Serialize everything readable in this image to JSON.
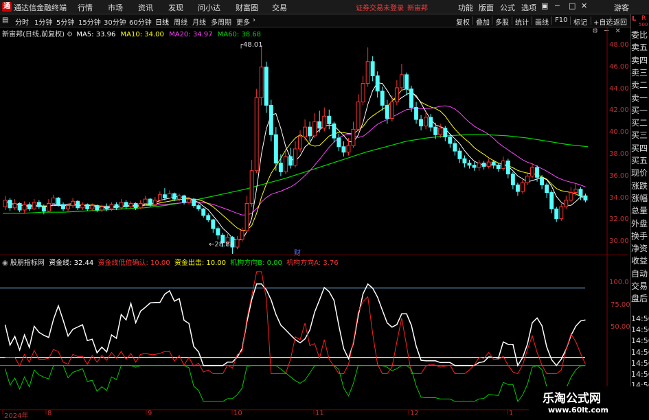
{
  "menubar": {
    "app_title": "通达信金融终端",
    "items": [
      "行情",
      "市场",
      "资讯",
      "发现",
      "问小达",
      "财富圈",
      "交易"
    ],
    "warning": "证券交易未登录",
    "stock": "新宙邦",
    "right_items": [
      "功能",
      "版面",
      "公式",
      "选项"
    ],
    "guest": "游客"
  },
  "periodbar": {
    "items": [
      "分时",
      "1分钟",
      "5分钟",
      "15分钟",
      "30分钟",
      "60分钟",
      "日线",
      "周线",
      "月线",
      "多周期",
      "更多"
    ],
    "active": "日线",
    "tools": [
      "复权",
      "叠加",
      "多股",
      "统计",
      "画线",
      "F10",
      "标记",
      "+自选",
      "返回"
    ]
  },
  "info": {
    "name": "新宙邦(日线,前复权)",
    "ma5": "MA5: 33.96",
    "ma10": "MA10: 34.00",
    "ma20": "MA20: 34.97",
    "ma60": "MA60: 38.68"
  },
  "colors": {
    "up": "#ff3232",
    "down": "#54ffff",
    "ma5": "#ffffff",
    "ma10": "#ffff00",
    "ma20": "#ff44ff",
    "ma60": "#00dd00"
  },
  "side_labels": [
    "委比",
    "卖五",
    "卖四",
    "卖三",
    "卖二",
    "卖一",
    "买一",
    "买二",
    "买三",
    "买四",
    "买五",
    "现价",
    "涨跌",
    "涨幅",
    "总量",
    "外盘",
    "换手",
    "净资",
    "收益",
    "自动",
    "交易",
    "盘后"
  ],
  "side_top": {
    "l": "L",
    "r": "R",
    "num": "500"
  },
  "price_axis": [
    "48.00",
    "46.00",
    "44.00",
    "42.00",
    "40.00",
    "38.00",
    "36.00",
    "34.00",
    "32.00",
    "30.00"
  ],
  "annotations": {
    "high": "48.01",
    "low": "28.88",
    "event": "财"
  },
  "indicator": {
    "name": "股朋指标网",
    "zjx": "资金线: 32.44",
    "dw": "资金线低位确认: 10.00",
    "cj": "资金出击: 10.00",
    "jgb": "机构方向B: 0.00",
    "jga": "机构方向A: 3.76",
    "axis": [
      "100.0",
      "75.00",
      "50.00"
    ],
    "time_labels": [
      "14:56",
      "14:56",
      "14:56",
      "14:56",
      "14:56",
      "14:56",
      "14:56"
    ]
  },
  "x_axis": [
    "2024年",
    "8",
    "9",
    "10",
    "11",
    "12",
    "1"
  ],
  "watermark": {
    "line1": "乐淘公式网",
    "line2": "www.60lt.com"
  },
  "chart_data": {
    "type": "candlestick",
    "title": "新宙邦(日线,前复权)",
    "price_range": [
      29.0,
      48.5
    ],
    "candles": [
      [
        33.2,
        33.8,
        34.2,
        32.9
      ],
      [
        33.8,
        33.1,
        34.0,
        32.8
      ],
      [
        33.1,
        33.5,
        33.9,
        32.9
      ],
      [
        33.5,
        32.9,
        33.6,
        32.7
      ],
      [
        32.9,
        33.4,
        33.7,
        32.6
      ],
      [
        33.4,
        33.0,
        33.6,
        32.8
      ],
      [
        33.0,
        33.6,
        33.9,
        32.9
      ],
      [
        33.6,
        33.2,
        33.8,
        33.0
      ],
      [
        33.2,
        32.8,
        33.4,
        32.5
      ],
      [
        32.8,
        33.5,
        33.9,
        32.7
      ],
      [
        33.5,
        34.0,
        34.3,
        33.3
      ],
      [
        34.0,
        33.4,
        34.1,
        33.2
      ],
      [
        33.4,
        33.0,
        33.6,
        32.8
      ],
      [
        33.0,
        33.3,
        33.5,
        32.8
      ],
      [
        33.3,
        33.7,
        34.0,
        33.1
      ],
      [
        33.7,
        33.1,
        33.8,
        32.9
      ],
      [
        33.1,
        33.4,
        33.6,
        32.9
      ],
      [
        33.4,
        33.0,
        33.5,
        32.8
      ],
      [
        33.0,
        33.3,
        33.5,
        32.8
      ],
      [
        33.3,
        32.9,
        33.4,
        32.7
      ],
      [
        32.9,
        33.2,
        33.4,
        32.7
      ],
      [
        33.2,
        33.0,
        33.5,
        32.8
      ],
      [
        33.0,
        33.4,
        33.6,
        32.8
      ],
      [
        33.4,
        33.1,
        33.6,
        32.9
      ],
      [
        33.1,
        33.6,
        33.9,
        33.0
      ],
      [
        33.6,
        33.2,
        33.8,
        33.0
      ],
      [
        33.2,
        33.5,
        33.7,
        33.0
      ],
      [
        33.5,
        33.1,
        33.6,
        32.9
      ],
      [
        33.1,
        33.5,
        33.8,
        33.0
      ],
      [
        33.5,
        33.9,
        34.2,
        33.3
      ],
      [
        33.9,
        33.4,
        34.0,
        33.2
      ],
      [
        33.4,
        33.8,
        34.1,
        33.2
      ],
      [
        33.8,
        34.3,
        34.6,
        33.6
      ],
      [
        34.3,
        34.0,
        34.9,
        33.8
      ],
      [
        34.0,
        34.4,
        34.7,
        33.9
      ],
      [
        34.4,
        33.9,
        34.5,
        33.7
      ],
      [
        33.9,
        34.2,
        34.4,
        33.7
      ],
      [
        34.2,
        33.6,
        34.3,
        33.4
      ],
      [
        33.6,
        33.9,
        34.1,
        33.4
      ],
      [
        33.9,
        33.3,
        34.0,
        33.1
      ],
      [
        33.3,
        33.0,
        33.5,
        32.8
      ],
      [
        33.0,
        32.4,
        33.1,
        32.2
      ],
      [
        32.4,
        32.0,
        32.6,
        31.8
      ],
      [
        32.0,
        31.2,
        32.1,
        30.8
      ],
      [
        31.2,
        30.6,
        31.4,
        30.2
      ],
      [
        30.6,
        29.9,
        30.8,
        29.5
      ],
      [
        29.9,
        30.4,
        30.7,
        29.6
      ],
      [
        30.4,
        29.5,
        30.5,
        28.88
      ],
      [
        29.5,
        30.2,
        30.5,
        29.3
      ],
      [
        30.2,
        31.0,
        31.3,
        30.0
      ],
      [
        31.0,
        33.5,
        34.2,
        30.9
      ],
      [
        33.5,
        36.5,
        37.5,
        33.2
      ],
      [
        36.5,
        43.2,
        44.0,
        36.3
      ],
      [
        43.2,
        46.0,
        48.01,
        42.5
      ],
      [
        46.0,
        42.5,
        46.5,
        41.8
      ],
      [
        42.5,
        39.8,
        43.0,
        39.2
      ],
      [
        39.8,
        37.2,
        40.5,
        36.5
      ],
      [
        37.2,
        36.4,
        38.0,
        36.0
      ],
      [
        36.4,
        37.8,
        38.5,
        36.2
      ],
      [
        37.8,
        37.0,
        38.6,
        36.7
      ],
      [
        37.0,
        38.5,
        39.2,
        36.8
      ],
      [
        38.5,
        39.6,
        40.2,
        38.2
      ],
      [
        39.6,
        40.5,
        41.2,
        39.3
      ],
      [
        40.5,
        39.7,
        41.0,
        39.2
      ],
      [
        39.7,
        41.0,
        41.8,
        39.5
      ],
      [
        41.0,
        40.4,
        42.0,
        40.0
      ],
      [
        40.4,
        41.5,
        42.3,
        40.1
      ],
      [
        41.5,
        40.8,
        42.1,
        40.3
      ],
      [
        40.8,
        39.5,
        41.0,
        39.1
      ],
      [
        39.5,
        38.7,
        39.9,
        38.3
      ],
      [
        38.7,
        38.2,
        39.2,
        37.8
      ],
      [
        38.2,
        38.8,
        39.5,
        37.9
      ],
      [
        38.8,
        40.3,
        41.0,
        38.6
      ],
      [
        40.3,
        42.8,
        43.5,
        40.1
      ],
      [
        42.8,
        44.5,
        45.2,
        42.5
      ],
      [
        44.5,
        46.5,
        47.8,
        44.2
      ],
      [
        46.5,
        45.2,
        47.0,
        44.7
      ],
      [
        45.2,
        43.8,
        45.6,
        43.2
      ],
      [
        43.8,
        42.5,
        44.2,
        42.0
      ],
      [
        42.5,
        41.3,
        43.0,
        40.8
      ],
      [
        41.3,
        42.8,
        43.4,
        41.0
      ],
      [
        42.8,
        44.1,
        44.8,
        42.5
      ],
      [
        44.1,
        45.3,
        46.3,
        43.8
      ],
      [
        45.3,
        44.0,
        45.5,
        43.4
      ],
      [
        44.0,
        42.3,
        44.3,
        41.9
      ],
      [
        42.3,
        41.2,
        42.8,
        40.8
      ],
      [
        41.2,
        40.6,
        41.6,
        40.2
      ],
      [
        40.6,
        41.4,
        41.9,
        40.3
      ],
      [
        41.4,
        40.5,
        41.7,
        40.1
      ],
      [
        40.5,
        39.8,
        40.9,
        39.4
      ],
      [
        39.8,
        40.4,
        40.8,
        39.5
      ],
      [
        40.4,
        39.6,
        40.6,
        39.2
      ],
      [
        39.6,
        39.0,
        39.9,
        38.6
      ],
      [
        39.0,
        38.3,
        39.3,
        37.9
      ],
      [
        38.3,
        37.6,
        38.6,
        37.2
      ],
      [
        37.6,
        37.2,
        37.9,
        36.8
      ],
      [
        37.2,
        37.0,
        37.5,
        36.7
      ],
      [
        37.0,
        36.8,
        37.3,
        36.5
      ],
      [
        36.8,
        37.2,
        37.5,
        36.5
      ],
      [
        37.2,
        36.9,
        37.4,
        36.6
      ],
      [
        36.9,
        37.3,
        37.6,
        36.7
      ],
      [
        37.3,
        37.0,
        37.5,
        36.7
      ],
      [
        37.0,
        36.7,
        37.2,
        36.4
      ],
      [
        36.7,
        37.4,
        37.8,
        36.5
      ],
      [
        37.4,
        36.2,
        37.6,
        35.8
      ],
      [
        36.2,
        35.2,
        36.4,
        34.8
      ],
      [
        35.2,
        34.6,
        35.4,
        34.2
      ],
      [
        34.6,
        35.4,
        35.7,
        34.4
      ],
      [
        35.4,
        36.0,
        36.4,
        35.2
      ],
      [
        36.0,
        36.8,
        37.2,
        35.8
      ],
      [
        36.8,
        35.9,
        37.0,
        35.5
      ],
      [
        35.9,
        35.2,
        36.1,
        34.8
      ],
      [
        35.2,
        34.5,
        35.4,
        34.0
      ],
      [
        34.5,
        33.0,
        34.7,
        32.6
      ],
      [
        33.0,
        32.1,
        33.2,
        31.8
      ],
      [
        32.1,
        33.2,
        33.5,
        31.9
      ],
      [
        33.2,
        33.8,
        34.2,
        33.0
      ],
      [
        33.8,
        34.5,
        35.0,
        33.6
      ],
      [
        34.5,
        34.8,
        35.3,
        34.2
      ],
      [
        34.8,
        34.2,
        35.0,
        33.8
      ],
      [
        34.2,
        33.8,
        34.4,
        33.6
      ]
    ],
    "ma60_series": [
      32.6,
      32.6,
      32.7,
      32.7,
      32.8,
      32.9,
      33.0,
      33.1,
      33.3,
      33.6,
      34.0,
      34.4,
      34.8,
      35.3,
      35.8,
      36.4,
      37.0,
      37.6,
      38.2,
      38.7,
      39.2,
      39.5,
      39.7,
      39.8,
      39.8,
      39.7,
      39.5,
      39.2,
      38.9,
      38.7
    ],
    "indicator_range": [
      -50,
      120
    ]
  }
}
